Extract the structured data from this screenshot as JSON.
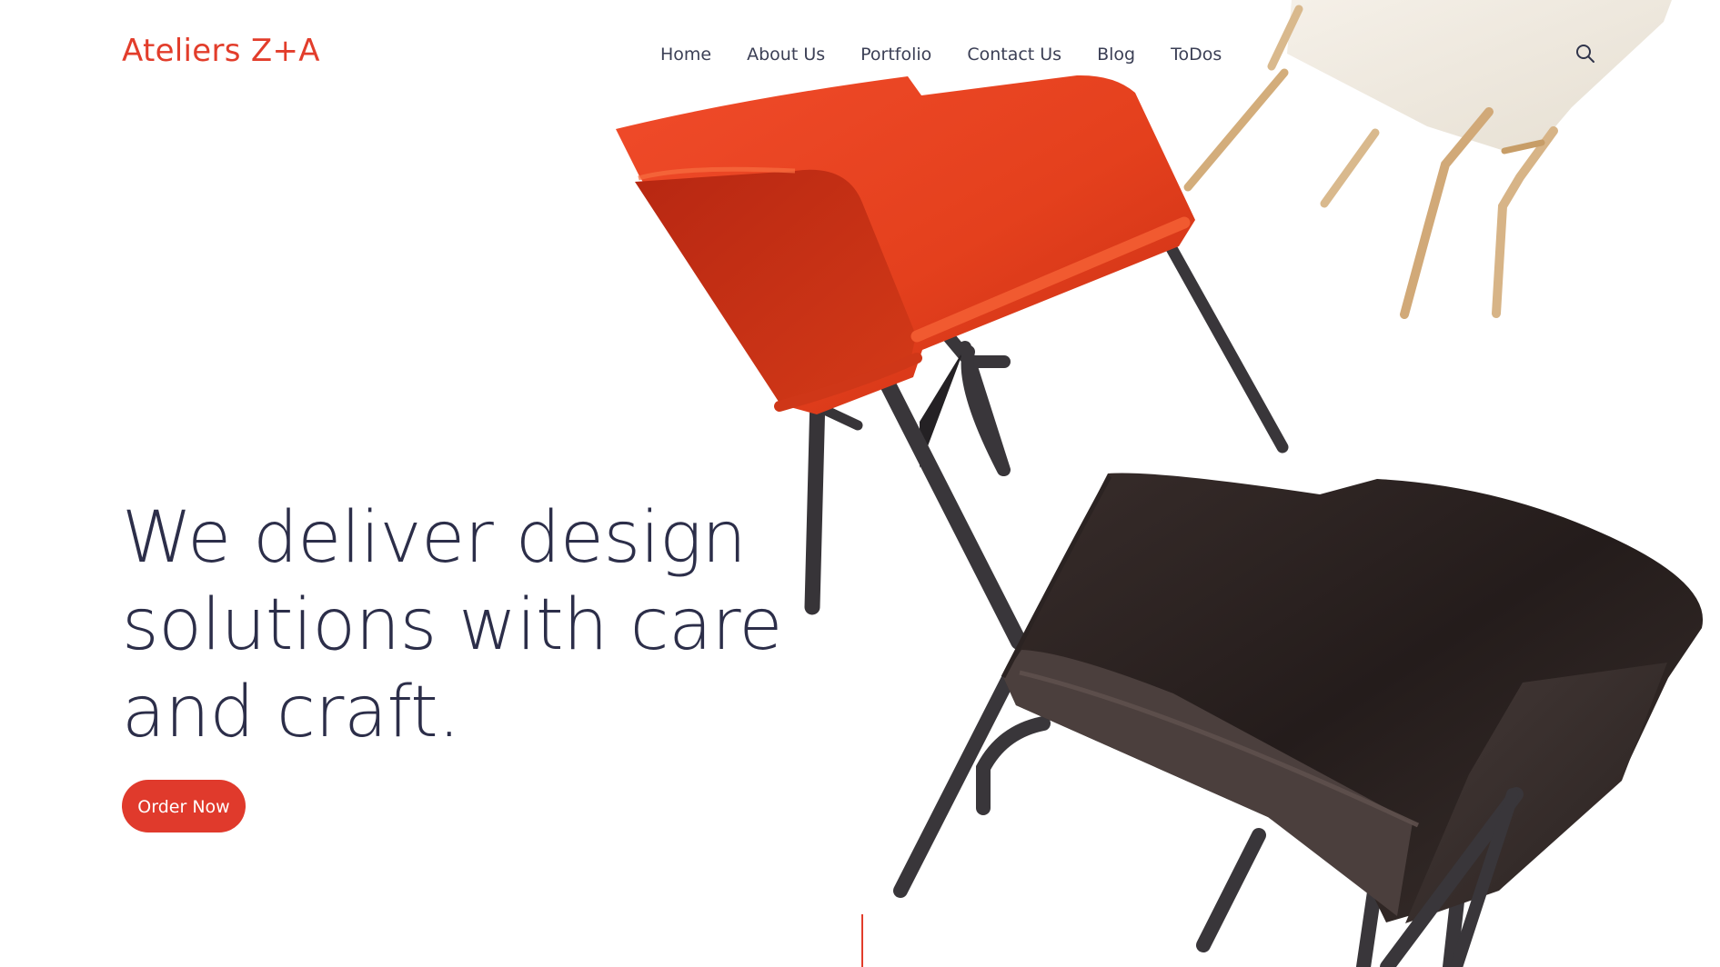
{
  "brand": {
    "name": "Ateliers Z+A",
    "accent_color": "#e23d2b"
  },
  "nav": {
    "items": [
      {
        "label": "Home"
      },
      {
        "label": "About Us"
      },
      {
        "label": "Portfolio"
      },
      {
        "label": "Contact Us"
      },
      {
        "label": "Blog"
      },
      {
        "label": "ToDos"
      }
    ],
    "text_color": "#3b3f55"
  },
  "search": {
    "icon": "search-icon"
  },
  "hero": {
    "headline_lines": [
      "We deliver design",
      "solutions with care",
      "and craft."
    ],
    "cta_label": "Order Now",
    "cta_color": "#e03a2c",
    "headline_color": "#2c2e49"
  },
  "hero_image": {
    "objects": [
      {
        "name": "orange-armchair",
        "color": "#e5401f"
      },
      {
        "name": "dark-brown-armchair",
        "color": "#2b2322"
      },
      {
        "name": "white-wooden-chair",
        "color": "#efe9dd"
      }
    ]
  },
  "scroll_indicator": {
    "color": "#e23d2b"
  }
}
